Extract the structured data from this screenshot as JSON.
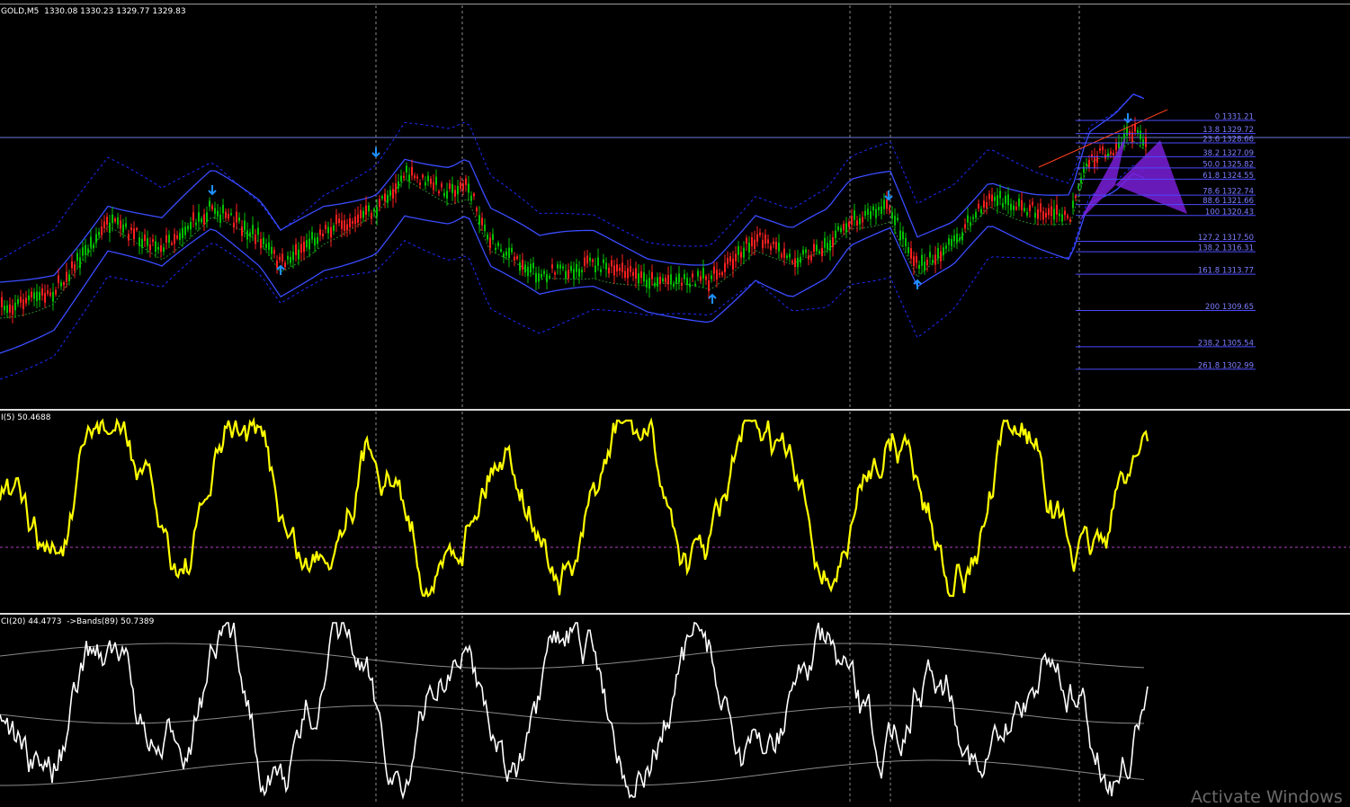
{
  "main": {
    "symbol_label": "GOLD,M5",
    "ohlc": "1330.08 1330.23 1329.77 1329.83",
    "fib_levels": [
      {
        "ratio": "0",
        "price": "1331.21"
      },
      {
        "ratio": "13.8",
        "price": "1329.72"
      },
      {
        "ratio": "23.6",
        "price": "1328.66"
      },
      {
        "ratio": "38.2",
        "price": "1327.09"
      },
      {
        "ratio": "50.0",
        "price": "1325.82"
      },
      {
        "ratio": "61.8",
        "price": "1324.55"
      },
      {
        "ratio": "78.6",
        "price": "1322.74"
      },
      {
        "ratio": "88.6",
        "price": "1321.66"
      },
      {
        "ratio": "100",
        "price": "1320.43"
      },
      {
        "ratio": "127.2",
        "price": "1317.50"
      },
      {
        "ratio": "138.2",
        "price": "1316.31"
      },
      {
        "ratio": "161.8",
        "price": "1313.77"
      },
      {
        "ratio": "200",
        "price": "1309.65"
      },
      {
        "ratio": "238.2",
        "price": "1305.54"
      },
      {
        "ratio": "261.8",
        "price": "1302.99"
      }
    ],
    "colors": {
      "bull_candle": "#00c000",
      "bear_candle": "#ff2020",
      "band": "#1e2aff",
      "envelope": "#3a4cff",
      "fib": "#4a4aff",
      "pattern": "#7a1fd8",
      "trendline": "#ff4020",
      "arrow": "#1e90ff"
    }
  },
  "rsi": {
    "label": "I(5) 50.4688",
    "color": "#ffff00",
    "level_color": "#b040c0"
  },
  "cci": {
    "label": "CI(20) 44.4773  ->Bands(89) 50.7389",
    "color": "#ffffff",
    "band_color": "#8a8a8a"
  },
  "watermark": "Activate Windows"
}
